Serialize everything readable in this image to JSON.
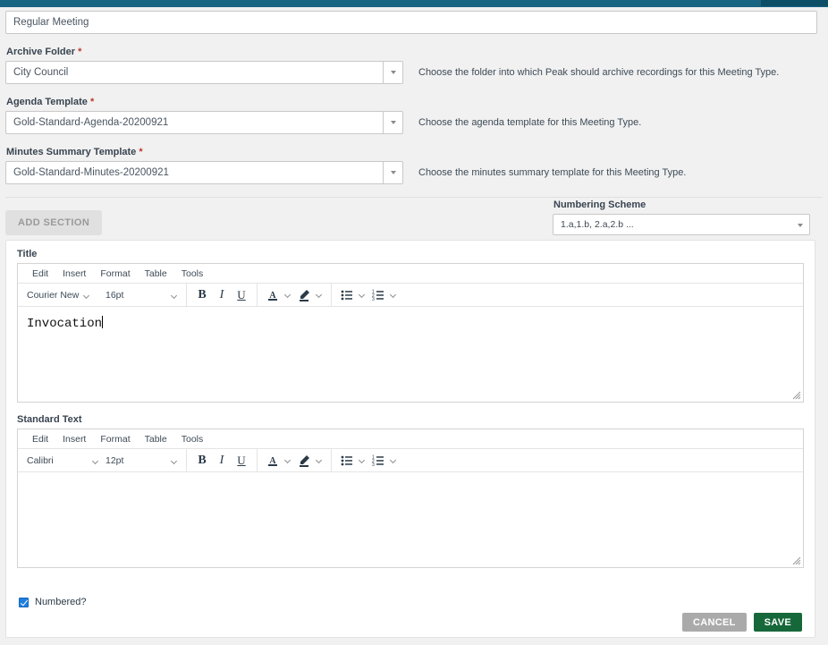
{
  "topbar": {
    "accent_color": "#176582",
    "accent_dark": "#0d4f66"
  },
  "form": {
    "title": {
      "label": "Title",
      "value": "Regular Meeting",
      "hint": ""
    },
    "archive_folder": {
      "label": "Archive Folder",
      "required_marker": "*",
      "value": "City Council",
      "hint": "Choose the folder into which Peak should archive recordings for this Meeting Type."
    },
    "agenda_template": {
      "label": "Agenda Template",
      "required_marker": "*",
      "value": "Gold-Standard-Agenda-20200921",
      "hint": "Choose the agenda template for this Meeting Type."
    },
    "minutes_template": {
      "label": "Minutes Summary Template",
      "required_marker": "*",
      "value": "Gold-Standard-Minutes-20200921",
      "hint": "Choose the minutes summary template for this Meeting Type."
    }
  },
  "actions": {
    "add_section_label": "ADD SECTION"
  },
  "numbering": {
    "label": "Numbering Scheme",
    "value": "1.a,1.b, 2.a,2.b ..."
  },
  "editor_menus": [
    "Edit",
    "Insert",
    "Format",
    "Table",
    "Tools"
  ],
  "section": {
    "title_editor": {
      "label": "Title",
      "font_family": "Courier New",
      "font_size": "16pt",
      "content": "Invocation",
      "menus": {
        "edit": "Edit",
        "insert": "Insert",
        "format": "Format",
        "table": "Table",
        "tools": "Tools"
      },
      "buttons": {
        "bold": "B",
        "italic": "I",
        "underline": "U",
        "text_color": "A"
      }
    },
    "standard_text_editor": {
      "label": "Standard Text",
      "font_family": "Calibri",
      "font_size": "12pt",
      "content": "",
      "menus": {
        "edit": "Edit",
        "insert": "Insert",
        "format": "Format",
        "table": "Table",
        "tools": "Tools"
      },
      "buttons": {
        "bold": "B",
        "italic": "I",
        "underline": "U",
        "text_color": "A"
      }
    },
    "numbered_checkbox": {
      "label": "Numbered?",
      "checked": true
    }
  },
  "footer": {
    "cancel_label": "CANCEL",
    "save_label": "SAVE",
    "save_color": "#16683a",
    "cancel_color": "#aaaaaa"
  }
}
